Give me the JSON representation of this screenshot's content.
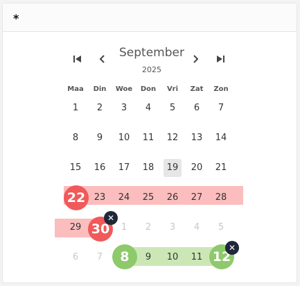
{
  "field": {
    "label": "*"
  },
  "calendar": {
    "month": "September",
    "year": "2025",
    "weekdays": [
      "Maa",
      "Din",
      "Woe",
      "Don",
      "Vri",
      "Zat",
      "Zon"
    ],
    "weeks": [
      [
        "1",
        "2",
        "3",
        "4",
        "5",
        "6",
        "7"
      ],
      [
        "8",
        "9",
        "10",
        "11",
        "12",
        "13",
        "14"
      ],
      [
        "15",
        "16",
        "17",
        "18",
        "19",
        "20",
        "21"
      ],
      [
        "22",
        "23",
        "24",
        "25",
        "26",
        "27",
        "28"
      ],
      [
        "29",
        "30",
        "1",
        "2",
        "3",
        "4",
        "5"
      ],
      [
        "6",
        "7",
        "8",
        "9",
        "10",
        "11",
        "12"
      ]
    ],
    "today": "19"
  },
  "ranges": [
    {
      "start": "22",
      "end": "30",
      "color": "#f05a5a",
      "band_color": "#fbbdbd"
    },
    {
      "start": "8",
      "end": "12",
      "color": "#8ec96b",
      "band_color": "#cce7b6"
    }
  ],
  "icons": {
    "first": "skip-to-first-icon",
    "prev": "chevron-left-icon",
    "next": "chevron-right-icon",
    "last": "skip-to-last-icon",
    "remove": "close-icon"
  }
}
